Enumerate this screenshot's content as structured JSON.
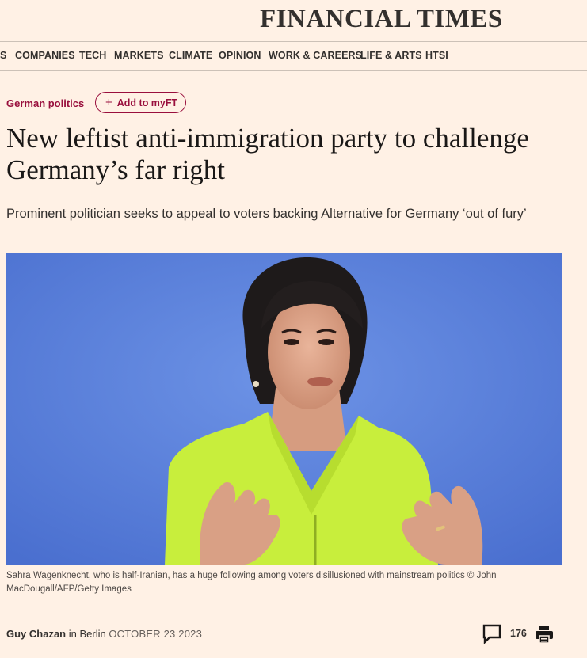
{
  "masthead": {
    "brand": "FINANCIAL TIMES"
  },
  "nav": {
    "items": [
      {
        "label": "S"
      },
      {
        "label": "COMPANIES"
      },
      {
        "label": "TECH"
      },
      {
        "label": "MARKETS"
      },
      {
        "label": "CLIMATE"
      },
      {
        "label": "OPINION"
      },
      {
        "label": "WORK & CAREERS"
      },
      {
        "label": "LIFE & ARTS"
      },
      {
        "label": "HTSI"
      }
    ]
  },
  "article": {
    "topic": "German politics",
    "myft_button": "Add to myFT",
    "headline": "New leftist anti-immigration party to challenge Germany’s far right",
    "standfirst": "Prominent politician seeks to appeal to voters backing Alternative for Germany ‘out of fury’",
    "image_caption": "Sahra Wagenknecht, who is half-Iranian, has a huge following among voters disillusioned with mainstream politics © John MacDougall/AFP/Getty Images",
    "byline": {
      "author": "Guy Chazan",
      "location_prefix": " in ",
      "location": "Berlin",
      "date": "OCTOBER 23 2023"
    },
    "comment_count": "176"
  },
  "icons": {
    "comments": "speech-bubble-icon",
    "print": "printer-icon",
    "add": "plus-icon"
  },
  "colors": {
    "background": "#fff1e5",
    "accent": "#990f3d",
    "image_backdrop": "#5a7fd8",
    "jacket": "#c8ee3c"
  }
}
